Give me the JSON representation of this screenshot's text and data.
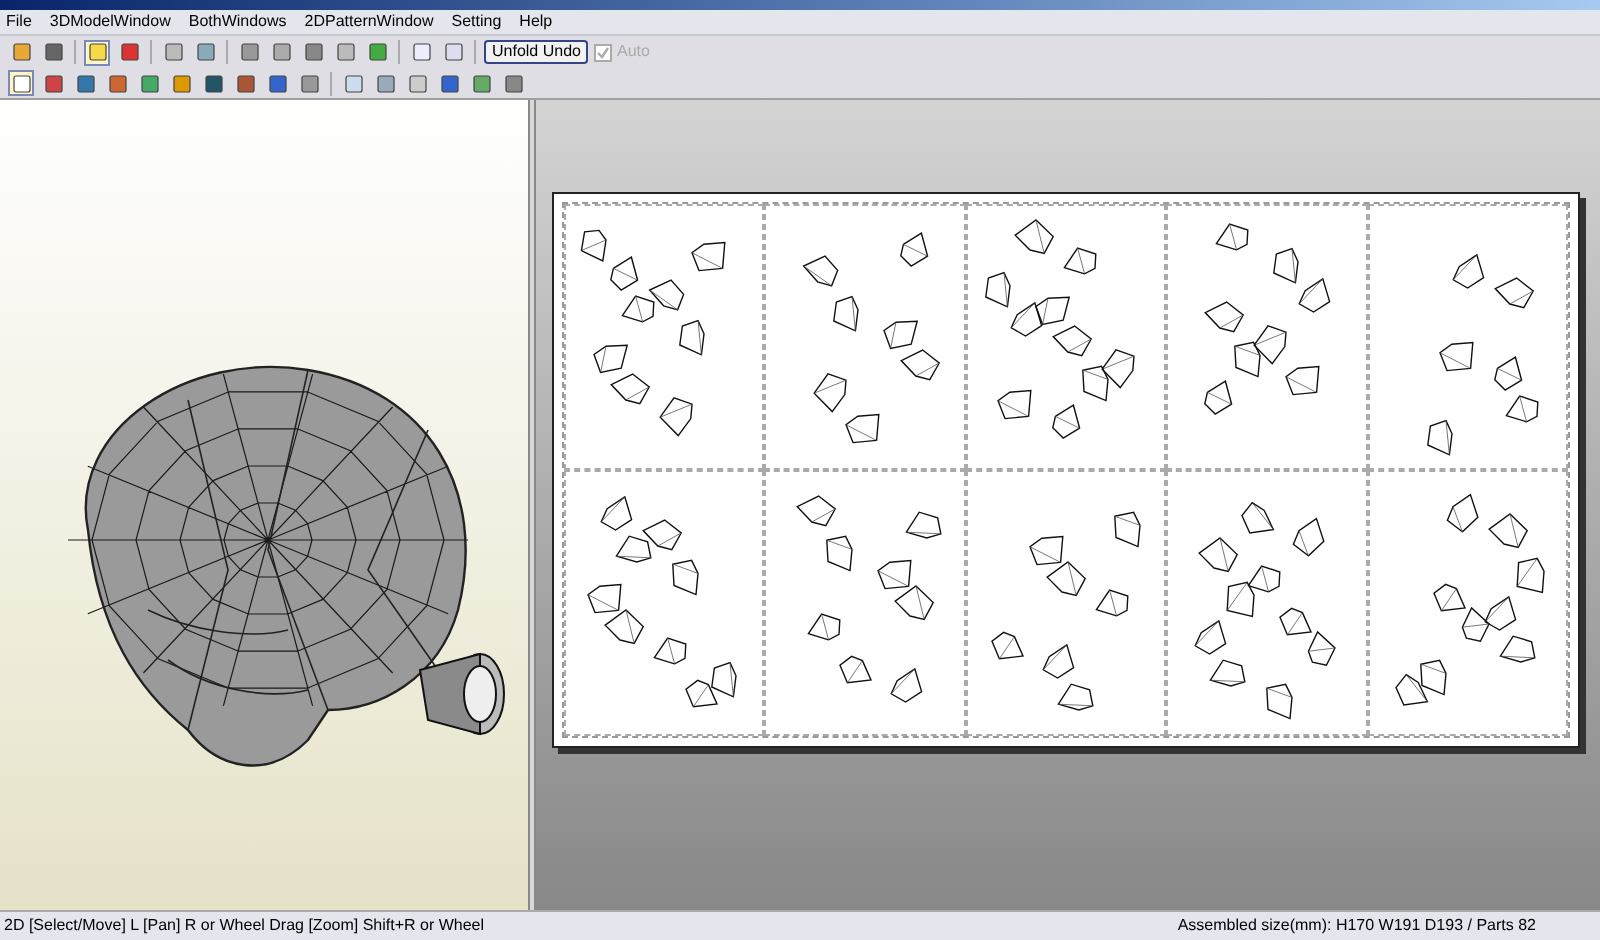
{
  "menu": [
    {
      "label": "File"
    },
    {
      "label": "3DModelWindow"
    },
    {
      "label": "BothWindows"
    },
    {
      "label": "2DPatternWindow"
    },
    {
      "label": "Setting"
    },
    {
      "label": "Help"
    }
  ],
  "toolbar_top": {
    "unfold_undo": "Unfold Undo",
    "auto": {
      "label": "Auto",
      "checked": true,
      "disabled": true
    },
    "light_on": true
  },
  "toolbar_bottom": {
    "select_mode_on": true
  },
  "status_bar": {
    "hint": "2D [Select/Move] L [Pan] R or Wheel Drag [Zoom] Shift+R or Wheel",
    "info": "Assembled size(mm): H170 W191 D193 / Parts 82"
  }
}
